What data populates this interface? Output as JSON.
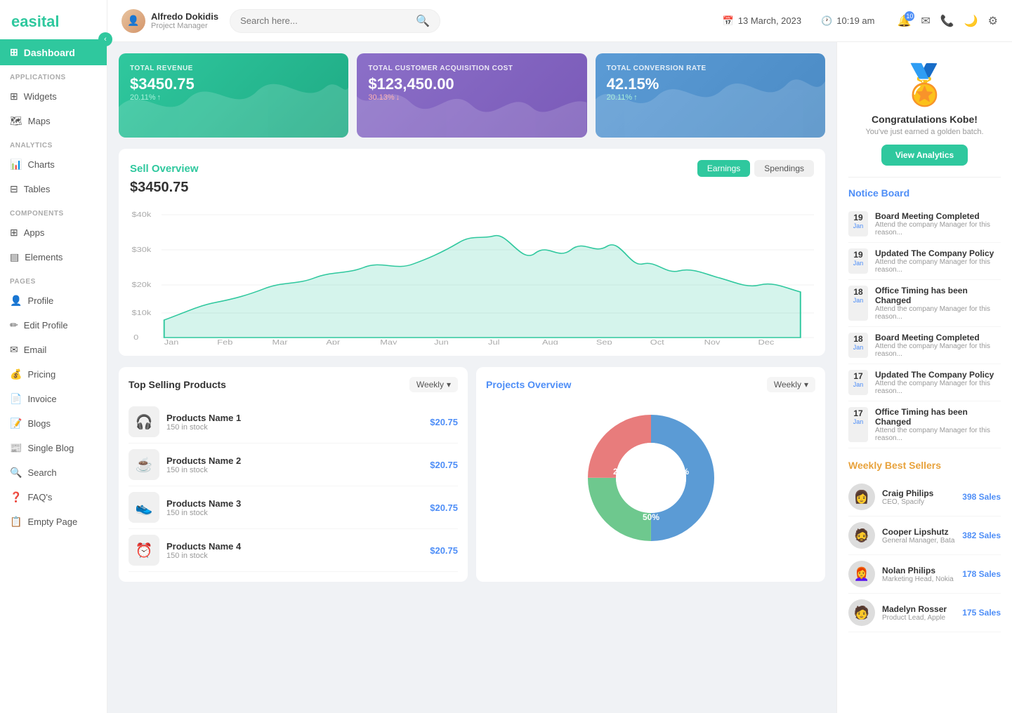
{
  "logo": {
    "text": "easital"
  },
  "sidebar": {
    "active": "Dashboard",
    "sections": [
      {
        "label": "APPLICATIONS",
        "items": [
          {
            "id": "widgets",
            "label": "Widgets",
            "icon": "⊞"
          },
          {
            "id": "maps",
            "label": "Maps",
            "icon": "🗺"
          }
        ]
      },
      {
        "label": "ANALYTICS",
        "items": [
          {
            "id": "charts",
            "label": "Charts",
            "icon": "📊"
          },
          {
            "id": "tables",
            "label": "Tables",
            "icon": "⊟"
          }
        ]
      },
      {
        "label": "COMPONENTS",
        "items": [
          {
            "id": "apps",
            "label": "Apps",
            "icon": "⊞"
          },
          {
            "id": "elements",
            "label": "Elements",
            "icon": "▤"
          }
        ]
      },
      {
        "label": "PAGES",
        "items": [
          {
            "id": "profile",
            "label": "Profile",
            "icon": "👤"
          },
          {
            "id": "edit-profile",
            "label": "Edit Profile",
            "icon": "✏"
          },
          {
            "id": "email",
            "label": "Email",
            "icon": "✉"
          },
          {
            "id": "pricing",
            "label": "Pricing",
            "icon": "💰"
          },
          {
            "id": "invoice",
            "label": "Invoice",
            "icon": "📄"
          },
          {
            "id": "blogs",
            "label": "Blogs",
            "icon": "📝"
          },
          {
            "id": "single-blog",
            "label": "Single Blog",
            "icon": "📰"
          },
          {
            "id": "search",
            "label": "Search",
            "icon": "🔍"
          },
          {
            "id": "faqs",
            "label": "FAQ's",
            "icon": "❓"
          },
          {
            "id": "empty-page",
            "label": "Empty Page",
            "icon": "📋"
          }
        ]
      }
    ]
  },
  "topbar": {
    "user": {
      "name": "Alfredo Dokidis",
      "role": "Project Manager"
    },
    "search_placeholder": "Search here...",
    "date": "13 March, 2023",
    "time": "10:19 am",
    "notification_count": "10"
  },
  "stats": [
    {
      "id": "revenue",
      "label": "TOTAL REVENUE",
      "value": "$3450.75",
      "change": "20.11%",
      "change_up": true,
      "color": "green"
    },
    {
      "id": "acquisition",
      "label": "TOTAL CUSTOMER ACQUISITION COST",
      "value": "$123,450.00",
      "change": "30.13%",
      "change_up": false,
      "color": "purple"
    },
    {
      "id": "conversion",
      "label": "TOTAL CONVERSION RATE",
      "value": "42.15%",
      "change": "20.11%",
      "change_up": true,
      "color": "blue"
    }
  ],
  "sell_overview": {
    "title": "Sell Overview",
    "amount": "$3450.75",
    "toggle_earnings": "Earnings",
    "toggle_spendings": "Spendings"
  },
  "chart_labels": [
    "Jan",
    "Feb",
    "Mar",
    "Apr",
    "May",
    "Jun",
    "Jul",
    "Aug",
    "Sep",
    "Oct",
    "Nov",
    "Dec"
  ],
  "top_selling": {
    "title": "Top Selling Products",
    "period": "Weekly",
    "products": [
      {
        "name": "Products Name 1",
        "stock": "150 in stock",
        "price": "$20.75",
        "emoji": "🎧"
      },
      {
        "name": "Products Name 2",
        "stock": "150 in stock",
        "price": "$20.75",
        "emoji": "☕"
      },
      {
        "name": "Products Name 3",
        "stock": "150 in stock",
        "price": "$20.75",
        "emoji": "👟"
      },
      {
        "name": "Products Name 4",
        "stock": "150 in stock",
        "price": "$20.75",
        "emoji": "⏰"
      }
    ]
  },
  "projects_overview": {
    "title": "Projects Overview",
    "period": "Weekly",
    "segments": [
      {
        "label": "25%",
        "value": 25,
        "color": "#e87c7c"
      },
      {
        "label": "25%",
        "value": 25,
        "color": "#6ec88e"
      },
      {
        "label": "50%",
        "value": 50,
        "color": "#5b9bd5"
      }
    ]
  },
  "badge": {
    "congrats": "Congratulations Kobe!",
    "sub": "You've just earned a golden batch.",
    "btn": "View Analytics"
  },
  "notice_board": {
    "title": "Notice Board",
    "items": [
      {
        "day": "19",
        "month": "Jan",
        "heading": "Board Meeting Completed",
        "sub": "Attend the company Manager for this reason..."
      },
      {
        "day": "19",
        "month": "Jan",
        "heading": "Updated The Company Policy",
        "sub": "Attend the company Manager for this reason..."
      },
      {
        "day": "18",
        "month": "Jan",
        "heading": "Office Timing has been Changed",
        "sub": "Attend the company Manager for this reason..."
      },
      {
        "day": "18",
        "month": "Jan",
        "heading": "Board Meeting Completed",
        "sub": "Attend the company Manager for this reason..."
      },
      {
        "day": "17",
        "month": "Jan",
        "heading": "Updated The Company Policy",
        "sub": "Attend the company Manager for this reason..."
      },
      {
        "day": "17",
        "month": "Jan",
        "heading": "Office Timing has been Changed",
        "sub": "Attend the company Manager for this reason..."
      }
    ]
  },
  "weekly_sellers": {
    "title": "Weekly Best Sellers",
    "sellers": [
      {
        "name": "Craig Philips",
        "role": "CEO, Spacify",
        "sales": "398 Sales",
        "emoji": "👩"
      },
      {
        "name": "Cooper Lipshutz",
        "role": "General Manager, Bata",
        "sales": "382 Sales",
        "emoji": "🧔"
      },
      {
        "name": "Nolan Philips",
        "role": "Marketing Head, Nokia",
        "sales": "178 Sales",
        "emoji": "👩‍🦰"
      },
      {
        "name": "Madelyn Rosser",
        "role": "Product Lead, Apple",
        "sales": "175 Sales",
        "emoji": "🧑"
      }
    ]
  }
}
